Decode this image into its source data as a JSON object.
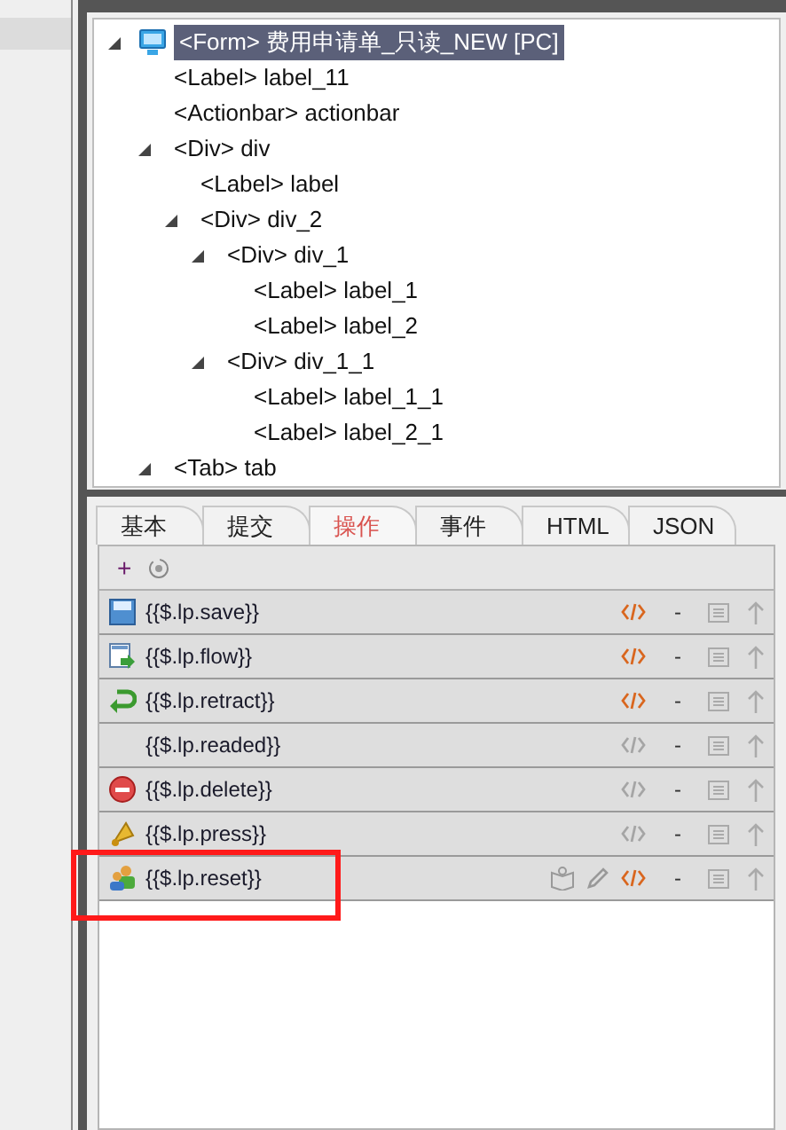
{
  "tree": [
    {
      "tag": "<Form>",
      "name": "费用申请单_只读_NEW [PC]",
      "selected": true,
      "expanded": true,
      "children": [
        {
          "tag": "<Label>",
          "name": "label_11",
          "selected": false
        },
        {
          "tag": "<Actionbar>",
          "name": "actionbar",
          "selected": false
        },
        {
          "tag": "<Div>",
          "name": "div",
          "selected": false,
          "expanded": true,
          "children": [
            {
              "tag": "<Label>",
              "name": "label",
              "selected": false
            },
            {
              "tag": "<Div>",
              "name": "div_2",
              "selected": false,
              "expanded": true,
              "children": [
                {
                  "tag": "<Div>",
                  "name": "div_1",
                  "selected": false,
                  "expanded": true,
                  "children": [
                    {
                      "tag": "<Label>",
                      "name": "label_1",
                      "selected": false
                    },
                    {
                      "tag": "<Label>",
                      "name": "label_2",
                      "selected": false
                    }
                  ]
                },
                {
                  "tag": "<Div>",
                  "name": "div_1_1",
                  "selected": false,
                  "expanded": true,
                  "children": [
                    {
                      "tag": "<Label>",
                      "name": "label_1_1",
                      "selected": false
                    },
                    {
                      "tag": "<Label>",
                      "name": "label_2_1",
                      "selected": false
                    }
                  ]
                }
              ]
            }
          ]
        },
        {
          "tag": "<Tab>",
          "name": "tab",
          "selected": false,
          "expanded": true
        }
      ]
    }
  ],
  "tabs": [
    {
      "label": "基本",
      "selected": false
    },
    {
      "label": "提交",
      "selected": false
    },
    {
      "label": "操作",
      "selected": true
    },
    {
      "label": "事件",
      "selected": false
    },
    {
      "label": "HTML",
      "selected": false
    },
    {
      "label": "JSON",
      "selected": false
    }
  ],
  "toolbar": {
    "add": "+"
  },
  "actions": [
    {
      "label": "{{$.lp.save}}",
      "kind": "save",
      "code_active": true,
      "extra_tools": false,
      "dash": "-"
    },
    {
      "label": "{{$.lp.flow}}",
      "kind": "flow",
      "code_active": true,
      "extra_tools": false,
      "dash": "-"
    },
    {
      "label": "{{$.lp.retract}}",
      "kind": "retract",
      "code_active": true,
      "extra_tools": false,
      "dash": "-"
    },
    {
      "label": "{{$.lp.readed}}",
      "kind": "plain",
      "code_active": false,
      "extra_tools": false,
      "dash": "-"
    },
    {
      "label": "{{$.lp.delete}}",
      "kind": "delete",
      "code_active": false,
      "extra_tools": false,
      "dash": "-"
    },
    {
      "label": "{{$.lp.press}}",
      "kind": "press",
      "code_active": false,
      "extra_tools": false,
      "dash": "-"
    },
    {
      "label": "{{$.lp.reset}}",
      "kind": "reset",
      "code_active": true,
      "extra_tools": true,
      "dash": "-"
    }
  ]
}
